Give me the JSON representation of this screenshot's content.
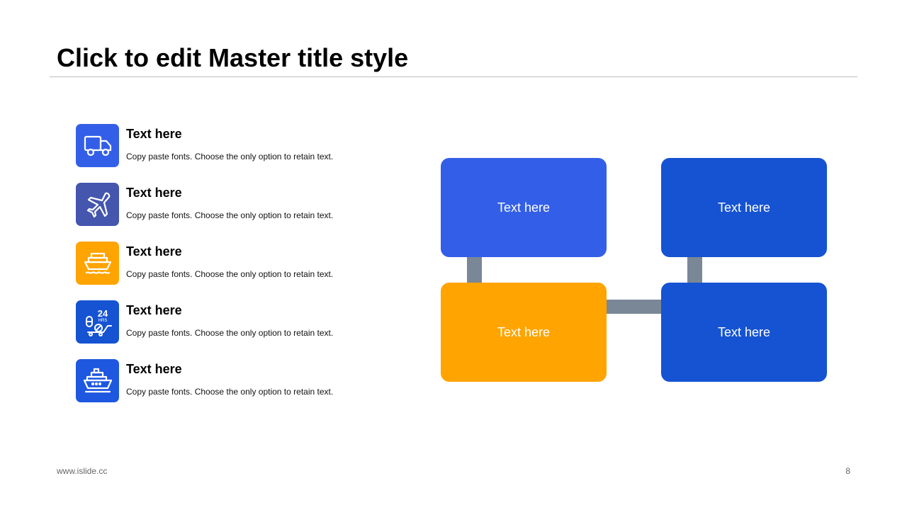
{
  "slide": {
    "title": "Click to edit Master title style"
  },
  "items": [
    {
      "title": "Text here",
      "desc": "Copy paste fonts. Choose the only option to retain text.",
      "icon": "truck-icon",
      "color": "#335FE8"
    },
    {
      "title": "Text here",
      "desc": "Copy paste fonts. Choose the only option to retain text.",
      "icon": "airplane-icon",
      "color": "#4456AE"
    },
    {
      "title": "Text here",
      "desc": "Copy paste fonts. Choose the only option to retain text.",
      "icon": "cargo-ship-icon",
      "color": "#FFA400"
    },
    {
      "title": "Text here",
      "desc": "Copy paste fonts. Choose the only option to retain text.",
      "icon": "24hrs-delivery-icon",
      "icon_text_top": "24",
      "icon_text_bottom": "HRS",
      "color": "#1553D2"
    },
    {
      "title": "Text here",
      "desc": "Copy paste fonts. Choose the only option to retain text.",
      "icon": "passenger-ship-icon",
      "color": "#1E57E0"
    }
  ],
  "diagram": {
    "boxes": [
      {
        "label": "Text here",
        "color": "#335FE8"
      },
      {
        "label": "Text here",
        "color": "#1553D2"
      },
      {
        "label": "Text here",
        "color": "#FFA400"
      },
      {
        "label": "Text here",
        "color": "#1553D2"
      }
    ],
    "connector_color": "#7A8797"
  },
  "footer": {
    "website": "www.islide.cc",
    "page_number": "8"
  }
}
